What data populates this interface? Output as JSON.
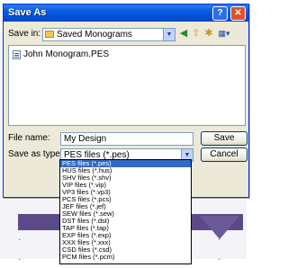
{
  "dialog": {
    "title": "Save As",
    "help_glyph": "?",
    "close_glyph": "✕"
  },
  "save_in": {
    "label": "Save in:",
    "value": "Saved Monograms",
    "folder_icon": "folder-icon"
  },
  "toolbar": {
    "icons": [
      "back-icon",
      "up-folder-icon",
      "new-folder-icon",
      "views-menu-icon"
    ]
  },
  "files": [
    {
      "name": "John Monogram.PES"
    }
  ],
  "file_name": {
    "label": "File name:",
    "value": "My Design"
  },
  "save_as_type": {
    "label": "Save as type:",
    "value": "PES files (*.pes)",
    "options": [
      "PES files (*.pes)",
      "HUS files (*.hus)",
      "SHV files (*.shv)",
      "VIP files (*.vip)",
      "VP3 files (*.vp3)",
      "PCS files (*.pcs)",
      "JEF files (*.jef)",
      "SEW files (*.sew)",
      "DST files (*.dst)",
      "TAP files (*.tap)",
      "EXP files (*.exp)",
      "XXX files (*.xxx)",
      "CSD files (*.csd)",
      "PCM files (*.pcm)"
    ]
  },
  "buttons": {
    "save": "Save",
    "cancel": "Cancel"
  },
  "colors": {
    "title_bar": "#0a5ae0",
    "selection": "#316ac5",
    "close_button": "#e0502a"
  }
}
